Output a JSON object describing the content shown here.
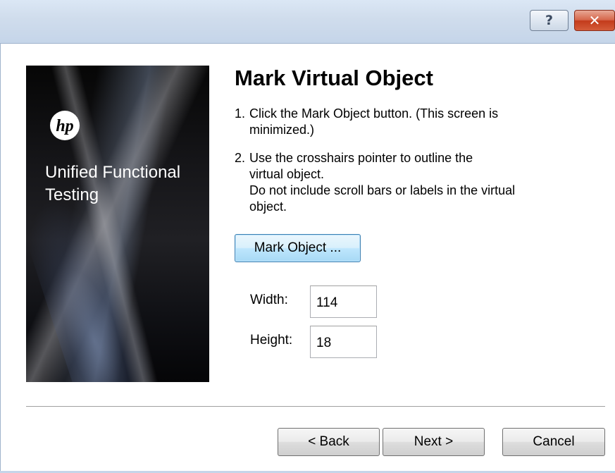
{
  "titlebar": {
    "help_label": "?",
    "close_label": "✕"
  },
  "banner": {
    "logo_icon": "hp-logo-icon",
    "logo_text": "hp",
    "product_line1": "Unified Functional",
    "product_line2": "Testing"
  },
  "main": {
    "title": "Mark Virtual Object",
    "step1": {
      "number": "1.",
      "line1": "Click the Mark Object button. (This screen is",
      "line2": "minimized.)"
    },
    "step2": {
      "number": "2.",
      "line1": "Use the crosshairs pointer to outline the",
      "line2": "virtual object.",
      "line3": "Do not include scroll bars or labels in the virtual",
      "line4": "object."
    },
    "mark_button_label": "Mark Object ...",
    "width_label": "Width:",
    "width_value": "114",
    "height_label": "Height:",
    "height_value": "18"
  },
  "footer": {
    "back_label": "< Back",
    "next_label": "Next >",
    "cancel_label": "Cancel"
  },
  "colors": {
    "titlebar": "#cfdcec",
    "close_button": "#c33b1b",
    "banner_background": "#151518",
    "mark_button_border": "#3c7fb1"
  }
}
